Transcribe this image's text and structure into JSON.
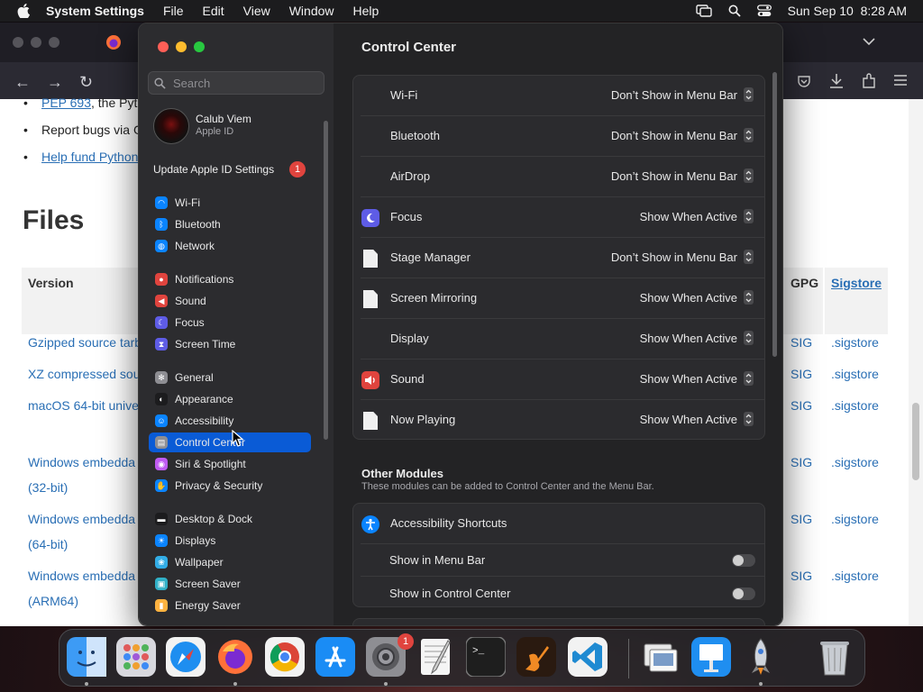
{
  "menubar": {
    "app": "System Settings",
    "menus": [
      "File",
      "Edit",
      "View",
      "Window",
      "Help"
    ],
    "datetime": "Sun Sep 10  8:28 AM"
  },
  "browser": {
    "bullets": [
      {
        "link": "PEP 693",
        "text": ", the Pyth"
      },
      {
        "link": "",
        "text": "Report bugs via G"
      },
      {
        "link": "Help fund Python",
        "text": ""
      }
    ],
    "heading": "Files",
    "table": {
      "col_version": "Version",
      "col_gpg": "GPG",
      "col_sigstore": "Sigstore",
      "rows": [
        {
          "label": "Gzipped source tarb",
          "sub": "",
          "sig": "SIG",
          "sigstore": ".sigstore"
        },
        {
          "label": "XZ compressed sou",
          "sub": "",
          "sig": "SIG",
          "sigstore": ".sigstore"
        },
        {
          "label": "macOS 64-bit unive",
          "sub": "",
          "sig": "SIG",
          "sigstore": ".sigstore"
        },
        {
          "label": "Windows embedda",
          "sub": "(32-bit)",
          "sig": "SIG",
          "sigstore": ".sigstore"
        },
        {
          "label": "Windows embedda",
          "sub": "(64-bit)",
          "sig": "SIG",
          "sigstore": ".sigstore"
        },
        {
          "label": "Windows embedda",
          "sub": "(ARM64)",
          "sig": "SIG",
          "sigstore": ".sigstore"
        }
      ]
    }
  },
  "sidebar": {
    "search_placeholder": "Search",
    "user_name": "Calub Viem",
    "user_sub": "Apple ID",
    "update_label": "Update Apple ID Settings",
    "update_badge": "1",
    "items": [
      {
        "label": "Wi-Fi",
        "icon": "wifi-icon",
        "color": "#0a84ff"
      },
      {
        "label": "Bluetooth",
        "icon": "bluetooth-icon",
        "color": "#0a84ff"
      },
      {
        "label": "Network",
        "icon": "globe-icon",
        "color": "#0a84ff"
      },
      {
        "label": "Notifications",
        "icon": "bell-icon",
        "color": "#e0443e"
      },
      {
        "label": "Sound",
        "icon": "speaker-icon",
        "color": "#e0443e"
      },
      {
        "label": "Focus",
        "icon": "moon-icon",
        "color": "#5e5ce6"
      },
      {
        "label": "Screen Time",
        "icon": "hourglass-icon",
        "color": "#5e5ce6"
      },
      {
        "label": "General",
        "icon": "gear-icon",
        "color": "#8e8e93"
      },
      {
        "label": "Appearance",
        "icon": "appearance-icon",
        "color": "#1c1c1e"
      },
      {
        "label": "Accessibility",
        "icon": "accessibility-icon",
        "color": "#0a84ff"
      },
      {
        "label": "Control Center",
        "icon": "control-center-icon",
        "color": "#8e8e93"
      },
      {
        "label": "Siri & Spotlight",
        "icon": "siri-icon",
        "color": "#bf5af2"
      },
      {
        "label": "Privacy & Security",
        "icon": "hand-icon",
        "color": "#0a84ff"
      },
      {
        "label": "Desktop & Dock",
        "icon": "dock-icon",
        "color": "#1c1c1e"
      },
      {
        "label": "Displays",
        "icon": "sun-icon",
        "color": "#0a84ff"
      },
      {
        "label": "Wallpaper",
        "icon": "wallpaper-icon",
        "color": "#32ade6"
      },
      {
        "label": "Screen Saver",
        "icon": "screensaver-icon",
        "color": "#30b0c7"
      },
      {
        "label": "Energy Saver",
        "icon": "battery-icon",
        "color": "#ffb340"
      }
    ]
  },
  "main": {
    "title": "Control Center",
    "modules": [
      {
        "label": "Wi-Fi",
        "value": "Don’t Show in Menu Bar",
        "icon": ""
      },
      {
        "label": "Bluetooth",
        "value": "Don’t Show in Menu Bar",
        "icon": ""
      },
      {
        "label": "AirDrop",
        "value": "Don’t Show in Menu Bar",
        "icon": ""
      },
      {
        "label": "Focus",
        "value": "Show When Active",
        "icon": "moon-icon"
      },
      {
        "label": "Stage Manager",
        "value": "Don’t Show in Menu Bar",
        "icon": "document-icon"
      },
      {
        "label": "Screen Mirroring",
        "value": "Show When Active",
        "icon": "document-icon"
      },
      {
        "label": "Display",
        "value": "Show When Active",
        "icon": ""
      },
      {
        "label": "Sound",
        "value": "Show When Active",
        "icon": "speaker-icon"
      },
      {
        "label": "Now Playing",
        "value": "Show When Active",
        "icon": "document-icon"
      }
    ],
    "other_title": "Other Modules",
    "other_sub": "These modules can be added to Control Center and the Menu Bar.",
    "accessibility_label": "Accessibility Shortcuts",
    "show_menu_bar": "Show in Menu Bar",
    "show_control_center": "Show in Control Center"
  },
  "dock": {
    "apps": [
      "finder-icon",
      "launchpad-icon",
      "safari-icon",
      "firefox-icon",
      "chrome-icon",
      "app-store-icon",
      "system-settings-icon",
      "textedit-icon",
      "terminal-icon",
      "garageband-icon",
      "vscode-icon",
      "preview-icon",
      "keynote-icon",
      "rocket-icon",
      "trash-icon"
    ],
    "settings_badge": "1"
  }
}
